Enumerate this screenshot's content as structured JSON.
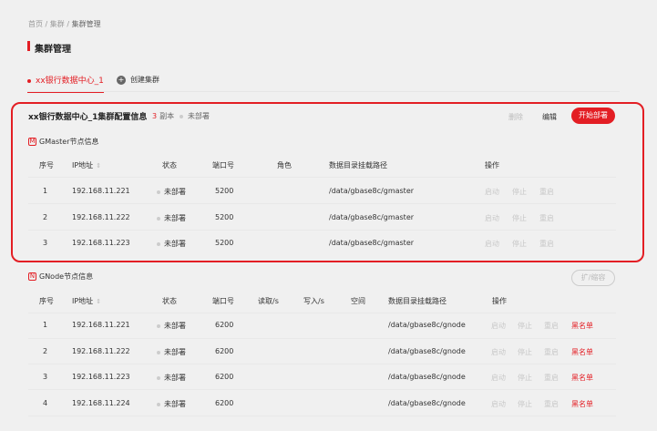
{
  "breadcrumb": {
    "home": "首页",
    "sep": "/",
    "cluster": "集群",
    "current": "集群管理"
  },
  "page_title": "集群管理",
  "tabs": {
    "active": "xx银行数据中心_1",
    "create": "创建集群"
  },
  "config": {
    "title": "xx银行数据中心_1集群配置信息",
    "replica_count": "3",
    "replica_label": "副本",
    "status": "未部署",
    "delete_label": "删除",
    "edit_label": "编辑",
    "deploy_label": "开始部署"
  },
  "gmaster": {
    "icon_letter": "M",
    "title": "GMaster节点信息",
    "headers": {
      "index": "序号",
      "ip": "IP地址",
      "status": "状态",
      "port": "端口号",
      "role": "角色",
      "path": "数据目录挂载路径",
      "ops": "操作"
    },
    "rows": [
      {
        "index": "1",
        "ip": "192.168.11.221",
        "status": "未部署",
        "port": "5200",
        "path": "/data/gbase8c/gmaster"
      },
      {
        "index": "2",
        "ip": "192.168.11.222",
        "status": "未部署",
        "port": "5200",
        "path": "/data/gbase8c/gmaster"
      },
      {
        "index": "3",
        "ip": "192.168.11.223",
        "status": "未部署",
        "port": "5200",
        "path": "/data/gbase8c/gmaster"
      }
    ],
    "ops": {
      "start": "启动",
      "stop": "停止",
      "restart": "重启"
    }
  },
  "gnode": {
    "icon_letter": "N",
    "title": "GNode节点信息",
    "expand_label": "扩/缩容",
    "headers": {
      "index": "序号",
      "ip": "IP地址",
      "status": "状态",
      "port": "端口号",
      "read": "读取/s",
      "write": "写入/s",
      "space": "空间",
      "path": "数据目录挂载路径",
      "ops": "操作"
    },
    "rows": [
      {
        "index": "1",
        "ip": "192.168.11.221",
        "status": "未部署",
        "port": "6200",
        "path": "/data/gbase8c/gnode"
      },
      {
        "index": "2",
        "ip": "192.168.11.222",
        "status": "未部署",
        "port": "6200",
        "path": "/data/gbase8c/gnode"
      },
      {
        "index": "3",
        "ip": "192.168.11.223",
        "status": "未部署",
        "port": "6200",
        "path": "/data/gbase8c/gnode"
      },
      {
        "index": "4",
        "ip": "192.168.11.224",
        "status": "未部署",
        "port": "6200",
        "path": "/data/gbase8c/gnode"
      }
    ],
    "ops": {
      "start": "启动",
      "stop": "停止",
      "restart": "重启",
      "blacklist": "黑名单"
    }
  },
  "colors": {
    "accent": "#e31e24",
    "background": "#f0f0f0",
    "disabled": "#c8c8c8"
  }
}
